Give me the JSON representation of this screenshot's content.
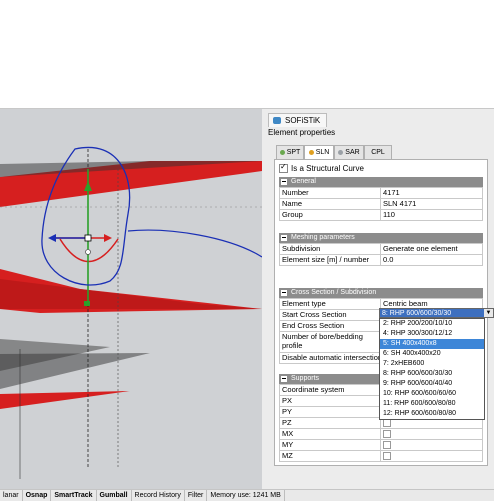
{
  "panel": {
    "title": "SOFiSTiK",
    "subtitle": "Element properties",
    "tabs": [
      {
        "label": "SPT",
        "color": "#6aa84f"
      },
      {
        "label": "SLN",
        "color": "#e0a020"
      },
      {
        "label": "SAR",
        "color": "#9aa0a6"
      },
      {
        "label": "CPL",
        "color": "#9aa0a6"
      }
    ],
    "structural_curve_label": "Is a Structural Curve",
    "sections": {
      "general": {
        "title": "General",
        "rows": [
          {
            "label": "Number",
            "value": "4171"
          },
          {
            "label": "Name",
            "value": "SLN 4171"
          },
          {
            "label": "Group",
            "value": "110"
          }
        ]
      },
      "meshing": {
        "title": "Meshing parameters",
        "rows": [
          {
            "label": "Subdivision",
            "value": "Generate one element"
          },
          {
            "label": "Element size [m] / number",
            "value": "0.0"
          }
        ]
      },
      "cross": {
        "title": "Cross Section / Subdivision",
        "rows": [
          {
            "label": "Element type",
            "value": "Centric beam"
          },
          {
            "label": "Start Cross Section",
            "value": ""
          },
          {
            "label": "End Cross Section",
            "value": ""
          },
          {
            "label": "Number of bore/bedding profile",
            "value": ""
          },
          {
            "label": "Disable automatic intersection",
            "value": ""
          }
        ]
      },
      "supports": {
        "title": "Supports",
        "rows": [
          {
            "label": "Coordinate system",
            "value": ""
          },
          {
            "label": "PX",
            "value": ""
          },
          {
            "label": "PY",
            "value": ""
          },
          {
            "label": "PZ",
            "value": ""
          },
          {
            "label": "MX",
            "value": ""
          },
          {
            "label": "MY",
            "value": ""
          },
          {
            "label": "MZ",
            "value": ""
          }
        ]
      }
    }
  },
  "cross_section_select": {
    "selected": "8: RHP 600/600/30/30",
    "options": [
      "2: RHP 200/200/10/10",
      "4: RHP 300/300/12/12",
      "5: SH 400x400x8",
      "6: SH 400x400x20",
      "7: 2xHEB600",
      "8: RHP 600/600/30/30",
      "9: RHP 600/600/40/40",
      "10: RHP 600/600/60/60",
      "11: RHP 600/600/80/80",
      "12: RHP 600/600/80/80"
    ],
    "highlighted_index": 2
  },
  "statusbar": {
    "items": [
      "lanar",
      "Osnap",
      "SmartTrack",
      "Gumball",
      "Record History",
      "Filter",
      "Memory use: 1241 MB"
    ],
    "bold": [
      false,
      true,
      true,
      true,
      false,
      false,
      false
    ]
  },
  "colors": {
    "viewport_bg": "#cfd1d4",
    "plane_red": "#d61f1f",
    "annotation_blue": "#1a2fb5",
    "selection": "#3d86d8"
  }
}
